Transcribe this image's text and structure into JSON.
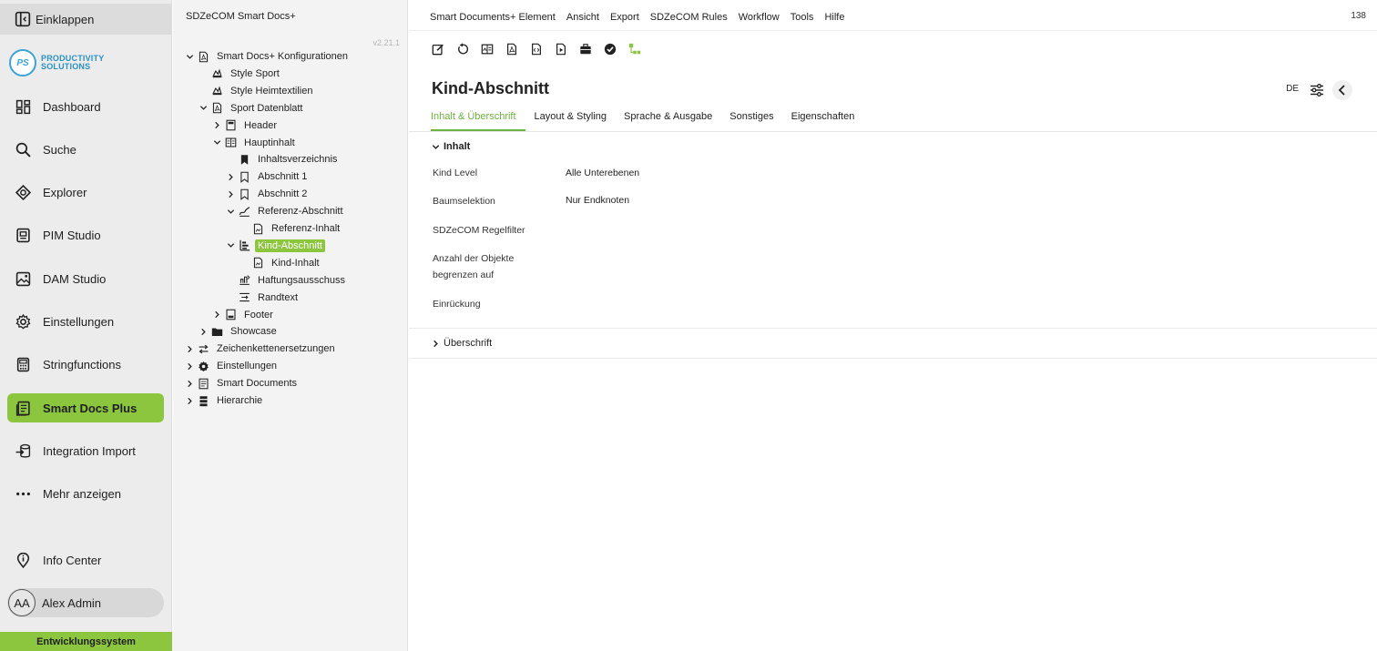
{
  "nav": {
    "collapse": "Einklappen",
    "logo": {
      "mark": "PS",
      "line1": "PRODUCTIVITY",
      "line2": "SOLUTIONS"
    },
    "items": [
      {
        "label": "Dashboard"
      },
      {
        "label": "Suche"
      },
      {
        "label": "Explorer"
      },
      {
        "label": "PIM Studio"
      },
      {
        "label": "DAM Studio"
      },
      {
        "label": "Einstellungen"
      },
      {
        "label": "Stringfunctions"
      },
      {
        "label": "Smart Docs Plus"
      },
      {
        "label": "Integration Import"
      },
      {
        "label": "Mehr anzeigen"
      },
      {
        "label": "Info Center"
      }
    ],
    "active": "Smart Docs Plus",
    "user": {
      "initials": "AA",
      "name": "Alex Admin"
    },
    "environment": "Entwicklungssystem",
    "accent_color": "#8cc63f"
  },
  "tree": {
    "title": "SDZeCOM Smart Docs+",
    "version": "v2.21.1",
    "nodes": [
      {
        "label": "Smart Docs+ Konfigurationen",
        "icon": "pdf-icon",
        "expanded": true
      },
      {
        "label": "Style Sport",
        "icon": "style-icon"
      },
      {
        "label": "Style Heimtextilien",
        "icon": "style-icon"
      },
      {
        "label": "Sport Datenblatt",
        "icon": "pdf-icon",
        "expanded": true
      },
      {
        "label": "Header",
        "icon": "header-icon"
      },
      {
        "label": "Hauptinhalt",
        "icon": "content-icon",
        "expanded": true
      },
      {
        "label": "Inhaltsverzeichnis",
        "icon": "toc-icon"
      },
      {
        "label": "Abschnitt 1",
        "icon": "section-icon"
      },
      {
        "label": "Abschnitt 2",
        "icon": "section-icon"
      },
      {
        "label": "Referenz-Abschnitt",
        "icon": "reference-icon",
        "expanded": true
      },
      {
        "label": "Referenz-Inhalt",
        "icon": "doc-content-icon"
      },
      {
        "label": "Kind-Abschnitt",
        "icon": "child-section-icon",
        "expanded": true,
        "selected": true
      },
      {
        "label": "Kind-Inhalt",
        "icon": "doc-content-icon"
      },
      {
        "label": "Haftungsausschuss",
        "icon": "disclaimer-icon"
      },
      {
        "label": "Randtext",
        "icon": "margin-text-icon"
      },
      {
        "label": "Footer",
        "icon": "footer-icon"
      },
      {
        "label": "Showcase",
        "icon": "folder-icon"
      },
      {
        "label": "Zeichenkettenersetzungen",
        "icon": "swap-icon"
      },
      {
        "label": "Einstellungen",
        "icon": "gear-icon"
      },
      {
        "label": "Smart Documents",
        "icon": "document-icon"
      },
      {
        "label": "Hierarchie",
        "icon": "hierarchy-icon"
      }
    ]
  },
  "main": {
    "menu": [
      "Smart Documents+ Element",
      "Ansicht",
      "Export",
      "SDZeCOM Rules",
      "Workflow",
      "Tools",
      "Hilfe"
    ],
    "menu_number": "138",
    "title": "Kind-Abschnitt",
    "language": "DE",
    "tabs": [
      "Inhalt & Überschrift",
      "Layout & Styling",
      "Sprache & Ausgabe",
      "Sonstiges",
      "Eigenschaften"
    ],
    "active_tab": "Inhalt & Überschrift",
    "sections": {
      "inhalt": "Inhalt",
      "ueberschrift": "Überschrift"
    },
    "fields": [
      {
        "label": "Kind Level",
        "value": "Alle Unterebenen"
      },
      {
        "label": "Baumselektion",
        "value": "Nur Endknoten"
      },
      {
        "label": "SDZeCOM Regelfilter",
        "value": ""
      },
      {
        "label": "Anzahl der Objekte begrenzen auf",
        "value": ""
      },
      {
        "label": "Einrückung",
        "value": ""
      }
    ]
  }
}
